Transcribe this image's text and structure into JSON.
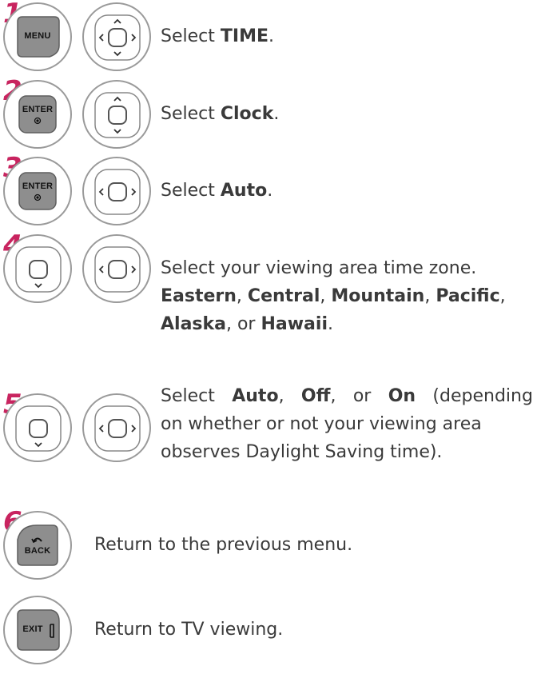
{
  "steps": [
    {
      "number": "1",
      "button": "MENU",
      "text_pre": "Select ",
      "bold": "TIME",
      "text_post": "."
    },
    {
      "number": "2",
      "button": "ENTER",
      "text_pre": "Select ",
      "bold": "Clock",
      "text_post": "."
    },
    {
      "number": "3",
      "button": "ENTER",
      "text_pre": "Select ",
      "bold": "Auto",
      "text_post": "."
    },
    {
      "number": "4",
      "text_line1": "Select your viewing area time zone.",
      "zones": [
        "Eastern",
        "Central",
        "Mountain",
        "Pacific",
        "Alaska",
        "Hawaii"
      ]
    },
    {
      "number": "5",
      "opt_auto": "Auto",
      "opt_off": "Off",
      "opt_on": "On",
      "line1_tail": "(depending",
      "line2": "on whether or not your viewing area",
      "line3": "observes Daylight Saving time)."
    },
    {
      "number": "6",
      "button": "BACK",
      "text": "Return to the previous menu."
    },
    {
      "button": "EXIT",
      "text": "Return to TV viewing."
    }
  ],
  "colors": {
    "step_number": "#c8245f",
    "button_fill": "#8e8e8e",
    "ring": "#9a9a9a"
  }
}
